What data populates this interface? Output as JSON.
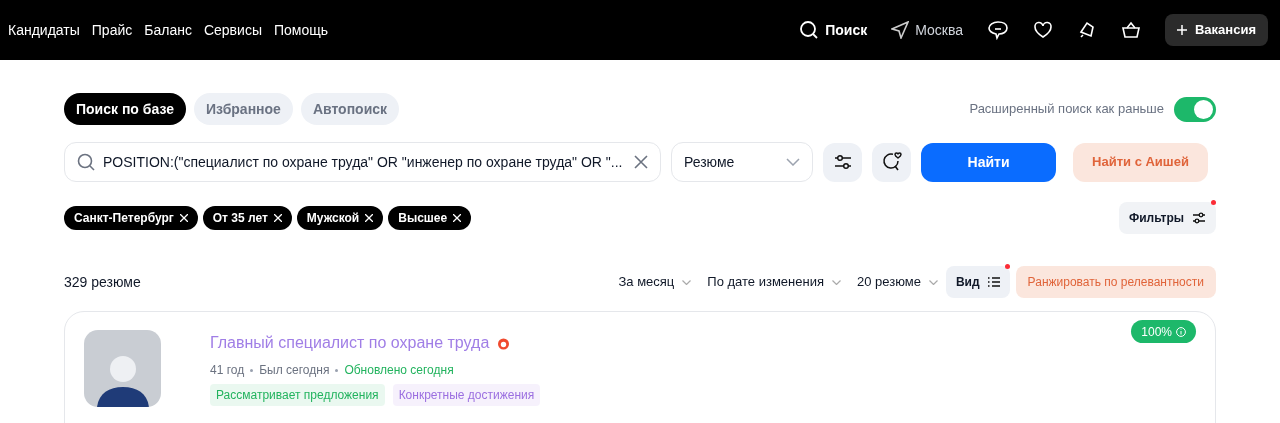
{
  "nav": {
    "links": [
      "Кандидаты",
      "Прайс",
      "Баланс",
      "Сервисы",
      "Помощь"
    ],
    "search": "Поиск",
    "city": "Москва",
    "vacancy_button": "Вакансия"
  },
  "tabs": [
    {
      "label": "Поиск по базе",
      "selected": true
    },
    {
      "label": "Избранное",
      "selected": false
    },
    {
      "label": "Автопоиск",
      "selected": false
    }
  ],
  "toggle": {
    "label": "Расширенный поиск как раньше",
    "on": true
  },
  "search": {
    "value": "POSITION:(\"специалист по охране труда\" OR \"инженер по охране труда\" OR \"...",
    "type_select": "Резюме",
    "find_button": "Найти",
    "ai_button": "Найти с Аишей"
  },
  "chips": [
    "Санкт-Петербург",
    "От 35 лет",
    "Мужской",
    "Высшее"
  ],
  "filters_button": {
    "label": "Фильтры",
    "dot": true
  },
  "results": {
    "count": "329 резюме",
    "sorts": [
      "За месяц",
      "По дате изменения",
      "20 резюме"
    ],
    "view_button": {
      "label": "Вид",
      "dot": true
    },
    "rank_button": "Ранжировать по релевантности"
  },
  "card": {
    "title": "Главный специалист по охране труда",
    "meta": [
      {
        "text": "41 год",
        "color": "#6b7280"
      },
      {
        "text": "Был сегодня",
        "color": "#6b7280"
      },
      {
        "text": "Обновлено сегодня",
        "color": "#22b35e"
      }
    ],
    "tags": [
      {
        "label": "Рассматривает предложения",
        "color": "#22b35e"
      },
      {
        "label": "Конкретные достижения",
        "color": "#9b6fe0"
      }
    ],
    "match": "100%"
  }
}
